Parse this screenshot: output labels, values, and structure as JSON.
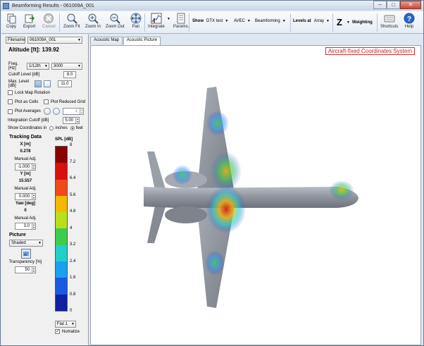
{
  "window": {
    "title": "Beamforming Results - 061009A_001"
  },
  "toolbar": {
    "copy": "Copy",
    "export": "Export",
    "cancel": "Cancel",
    "zoom_fit": "Zoom Fit",
    "zoom_in": "Zoom In",
    "zoom_out": "Zoom Out",
    "pan": "Pan",
    "integrate": "Integrate",
    "params": "Params.",
    "show_label": "Show",
    "show_value": "DTX test",
    "avec_value": "AVEC",
    "beam_value": "Beamforming",
    "levels_label": "Levels at",
    "levels_value": "Array",
    "z_label": "Z",
    "weighting": "Weighting",
    "shortcuts": "Shortcuts",
    "help": "Help"
  },
  "left": {
    "filename_label": "Filename",
    "filename_value": "061009A_001",
    "altitude": "Altitude [ft]: 139.92",
    "freq_label": "Freq. [Hz]",
    "freq_band": "1/12th",
    "freq_value": "3000",
    "cutoff_label": "Cutoff Level [dB]",
    "cutoff_value": "8.0",
    "maxlevel_label": "Max. Level [dB]",
    "maxlevel_value": "11.0",
    "lock_map": "Lock Map Rotation",
    "plot_cells": "Plot as Cells",
    "plot_reduced": "Plot Reduced Grid",
    "plot_averages": "Plot Averages",
    "avg_value": "1",
    "integration_label": "Integration Cutoff [dB]",
    "integration_value": "5.00",
    "coords_label": "Show Coordinates in",
    "coord_inches": "inches",
    "coord_feet": "feet",
    "tracking_title": "Tracking Data",
    "x_label": "X [m]",
    "x_value": "0.278",
    "x_adj_label": "Manual Adj.",
    "x_adj_value": "-1.000",
    "y_label": "Y [m]",
    "y_value": "15.557",
    "y_adj_label": "Manual Adj.",
    "y_adj_value": "0.000",
    "yaw_label": "Yaw [deg]",
    "yaw_value": "0",
    "yaw_adj_label": "Manual Adj.",
    "yaw_adj_value": "3.0",
    "picture_title": "Picture",
    "picture_mode": "Shaded",
    "transparency_label": "Transparency [%]",
    "transparency_value": "50",
    "spl_label": "SPL [dB]",
    "spl_ticks": [
      "8",
      "7.2",
      "6.4",
      "5.6",
      "4.8",
      "4",
      "3.2",
      "2.4",
      "1.6",
      "0.8",
      "0"
    ],
    "flat_value": "Flat 1",
    "normalize": "Nomalize"
  },
  "tabs": [
    "Acoustic Map",
    "Acoustic Picture"
  ],
  "canvas": {
    "coord_system": "Aircraft-fixed Coordinates System"
  },
  "colors": {
    "accent": "#d02020",
    "panel": "#f0f0f0",
    "frame": "#dfe7f1"
  }
}
